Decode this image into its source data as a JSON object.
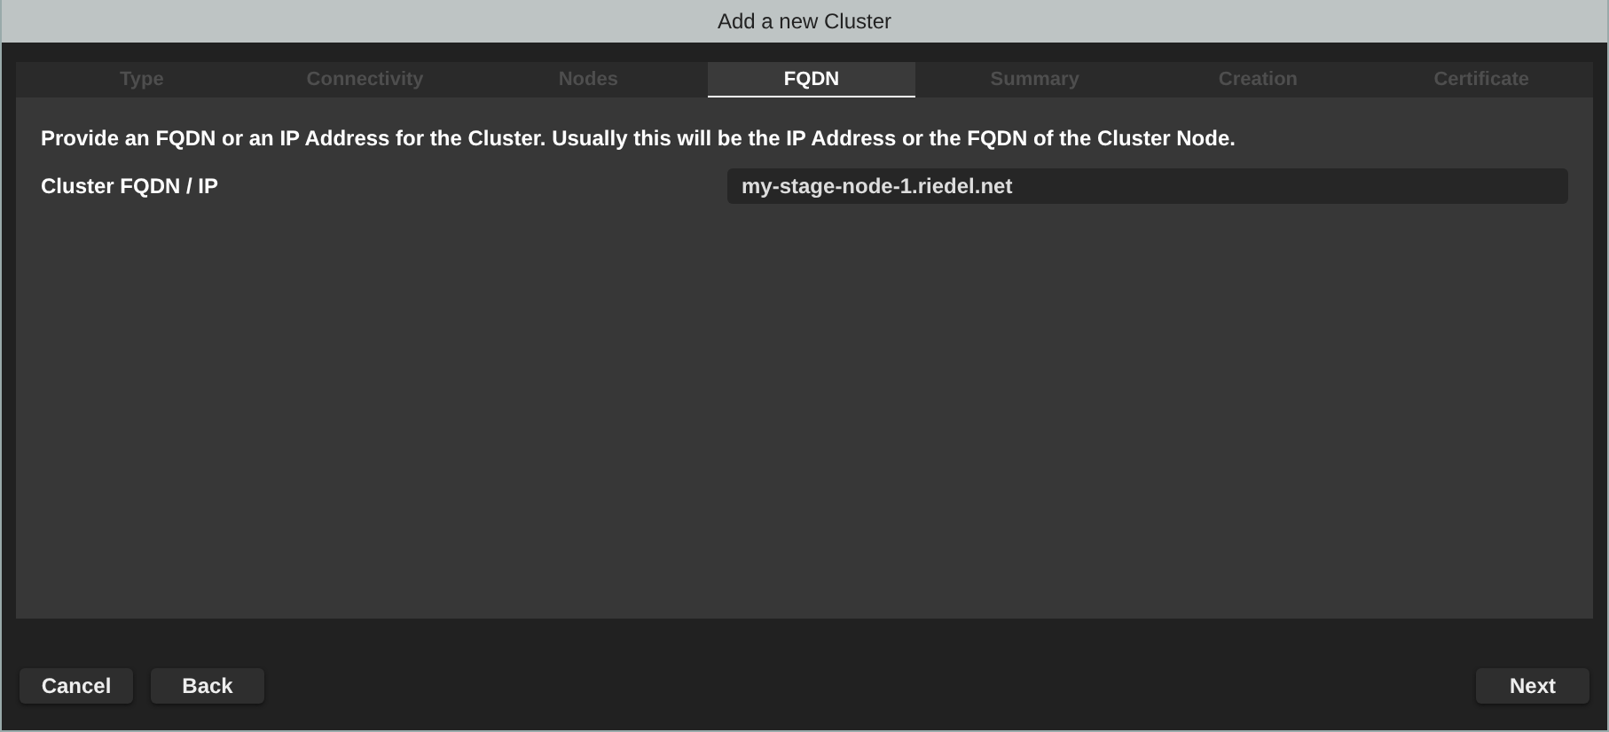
{
  "window": {
    "title": "Add a new Cluster"
  },
  "tabs": [
    {
      "label": "Type",
      "selected": false
    },
    {
      "label": "Connectivity",
      "selected": false
    },
    {
      "label": "Nodes",
      "selected": false
    },
    {
      "label": "FQDN",
      "selected": true
    },
    {
      "label": "Summary",
      "selected": false
    },
    {
      "label": "Creation",
      "selected": false
    },
    {
      "label": "Certificate",
      "selected": false
    }
  ],
  "description": "Provide an FQDN or an IP Address for the Cluster. Usually this will be the IP Address or the FQDN of the Cluster Node.",
  "field": {
    "label": "Cluster FQDN / IP",
    "value": "my-stage-node-1.riedel.net"
  },
  "buttons_left": [
    "Cancel",
    "Back"
  ],
  "buttons_right": [
    "Next"
  ]
}
